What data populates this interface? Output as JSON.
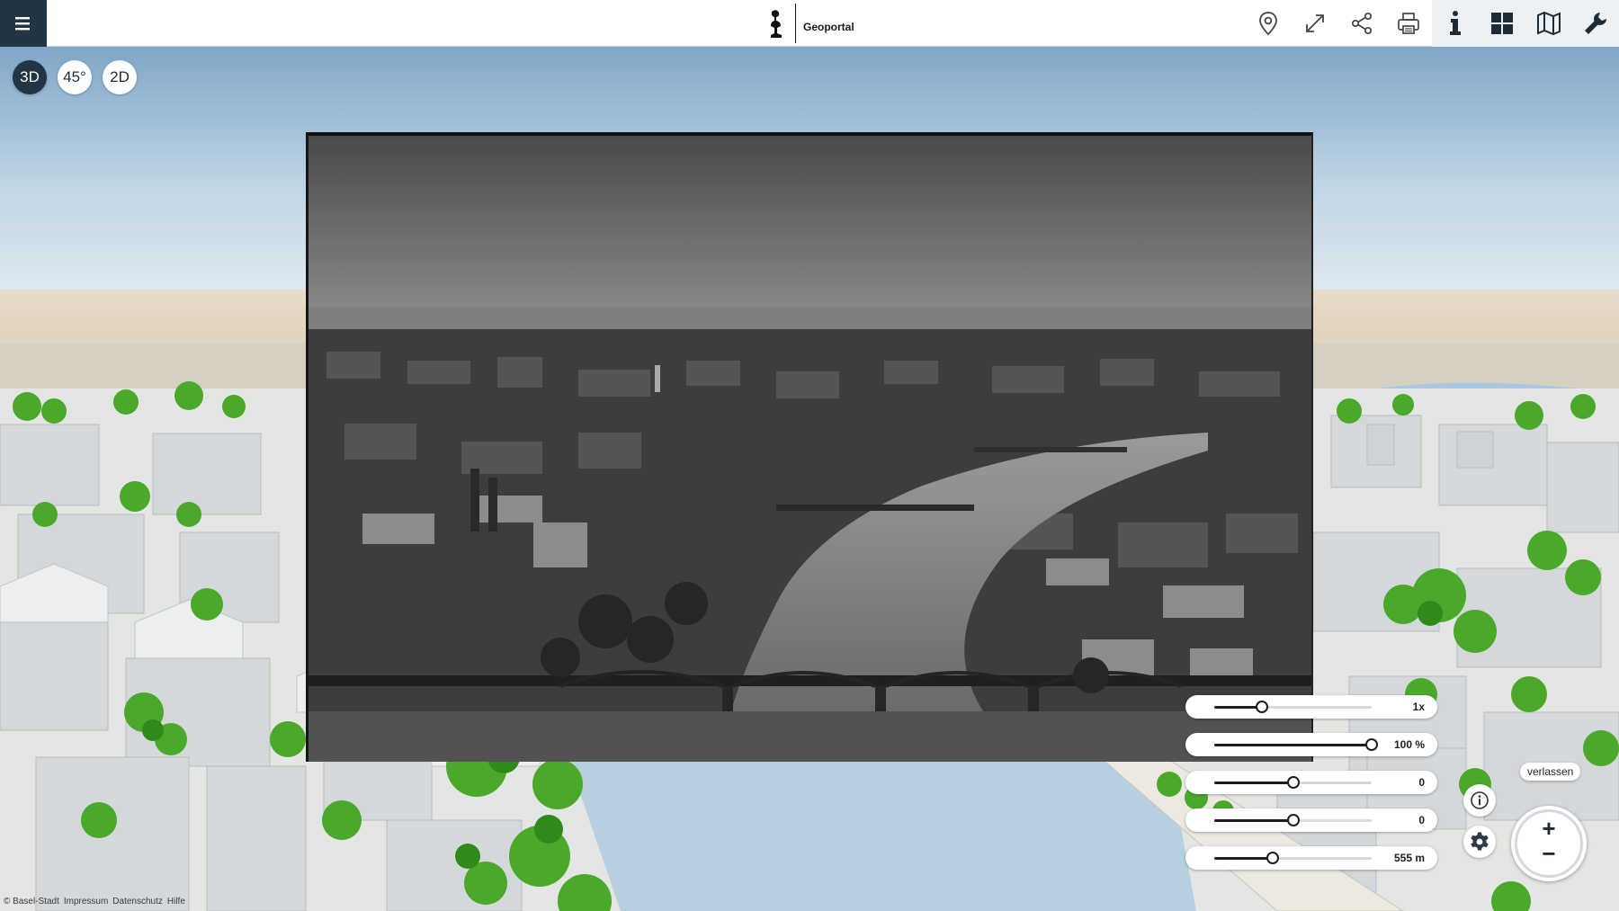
{
  "header": {
    "title": "Geoportal",
    "menu_icon": "hamburger-menu-icon",
    "tools": [
      {
        "name": "location-pin-icon",
        "label": "Standort"
      },
      {
        "name": "fullscreen-icon",
        "label": "Vollbild"
      },
      {
        "name": "share-icon",
        "label": "Teilen"
      },
      {
        "name": "print-icon",
        "label": "Drucken"
      },
      {
        "name": "info-icon",
        "label": "Info"
      },
      {
        "name": "grid-icon",
        "label": "Themen"
      },
      {
        "name": "map-icon",
        "label": "Karten"
      },
      {
        "name": "wrench-icon",
        "label": "Werkzeuge"
      }
    ]
  },
  "view_modes": {
    "active": "3D",
    "items": [
      "3D",
      "45°",
      "2D"
    ]
  },
  "overlay_controls": {
    "sliders": [
      {
        "value_label": "1x",
        "position": 0.3
      },
      {
        "value_label": "100 %",
        "position": 1.0
      },
      {
        "value_label": "0",
        "position": 0.5
      },
      {
        "value_label": "0",
        "position": 0.5
      },
      {
        "value_label": "555 m",
        "position": 0.37
      }
    ],
    "exit_label": "verlassen",
    "info_icon": "info-circle-icon",
    "settings_icon": "gear-icon",
    "zoom_in_label": "+",
    "zoom_out_label": "−"
  },
  "footer": {
    "copyright": "© Basel-Stadt",
    "links": [
      "Impressum",
      "Datenschutz",
      "Hilfe"
    ]
  },
  "colors": {
    "primary_dark": "#213545",
    "slider_fill": "#1e1e1e",
    "river": "#b8cfdf",
    "trees": "#4aa82a",
    "buildings": "#d8dadc"
  }
}
